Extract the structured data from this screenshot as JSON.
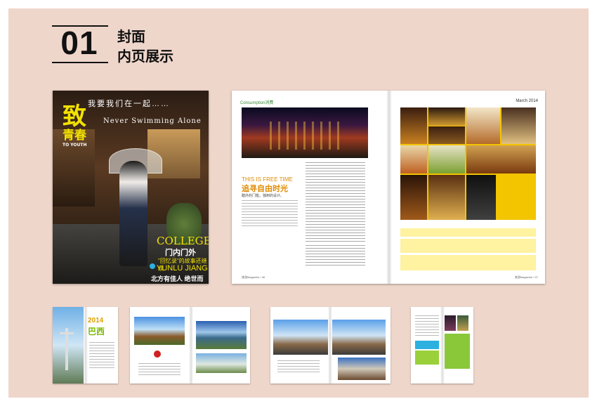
{
  "heading": {
    "number": "01",
    "line1": "封面",
    "line2": "内页展示"
  },
  "cover": {
    "top_slogan": "我要我们在一起……",
    "title_big": "致",
    "title_small": "青春",
    "title_en": "TO YOUTH",
    "subtitle": "Never Swimming Alone",
    "college": "COLLEGE",
    "college_cn": "门内门外",
    "small_text": "\"回忆录\"的故事还继续",
    "yunlu": "YUNLU JIANG",
    "north": "北方有佳人 绝世而独立"
  },
  "spread": {
    "brand": "Consumption消费",
    "month": "March 2014",
    "kicker": "THIS IS FREE TIME",
    "headline": "追寻自由时光",
    "subline": "踏外的门槛，独到的设计。",
    "footer_left": "旅游Magazine / 46",
    "footer_right": "旅游Magazine / 47"
  },
  "thumb1": {
    "year": "2014",
    "title": "巴西"
  },
  "colors": {
    "board": "#efd6cb",
    "accent_yellow": "#f3e300",
    "accent_orange": "#e08a00",
    "green": "#3a8a3a"
  }
}
